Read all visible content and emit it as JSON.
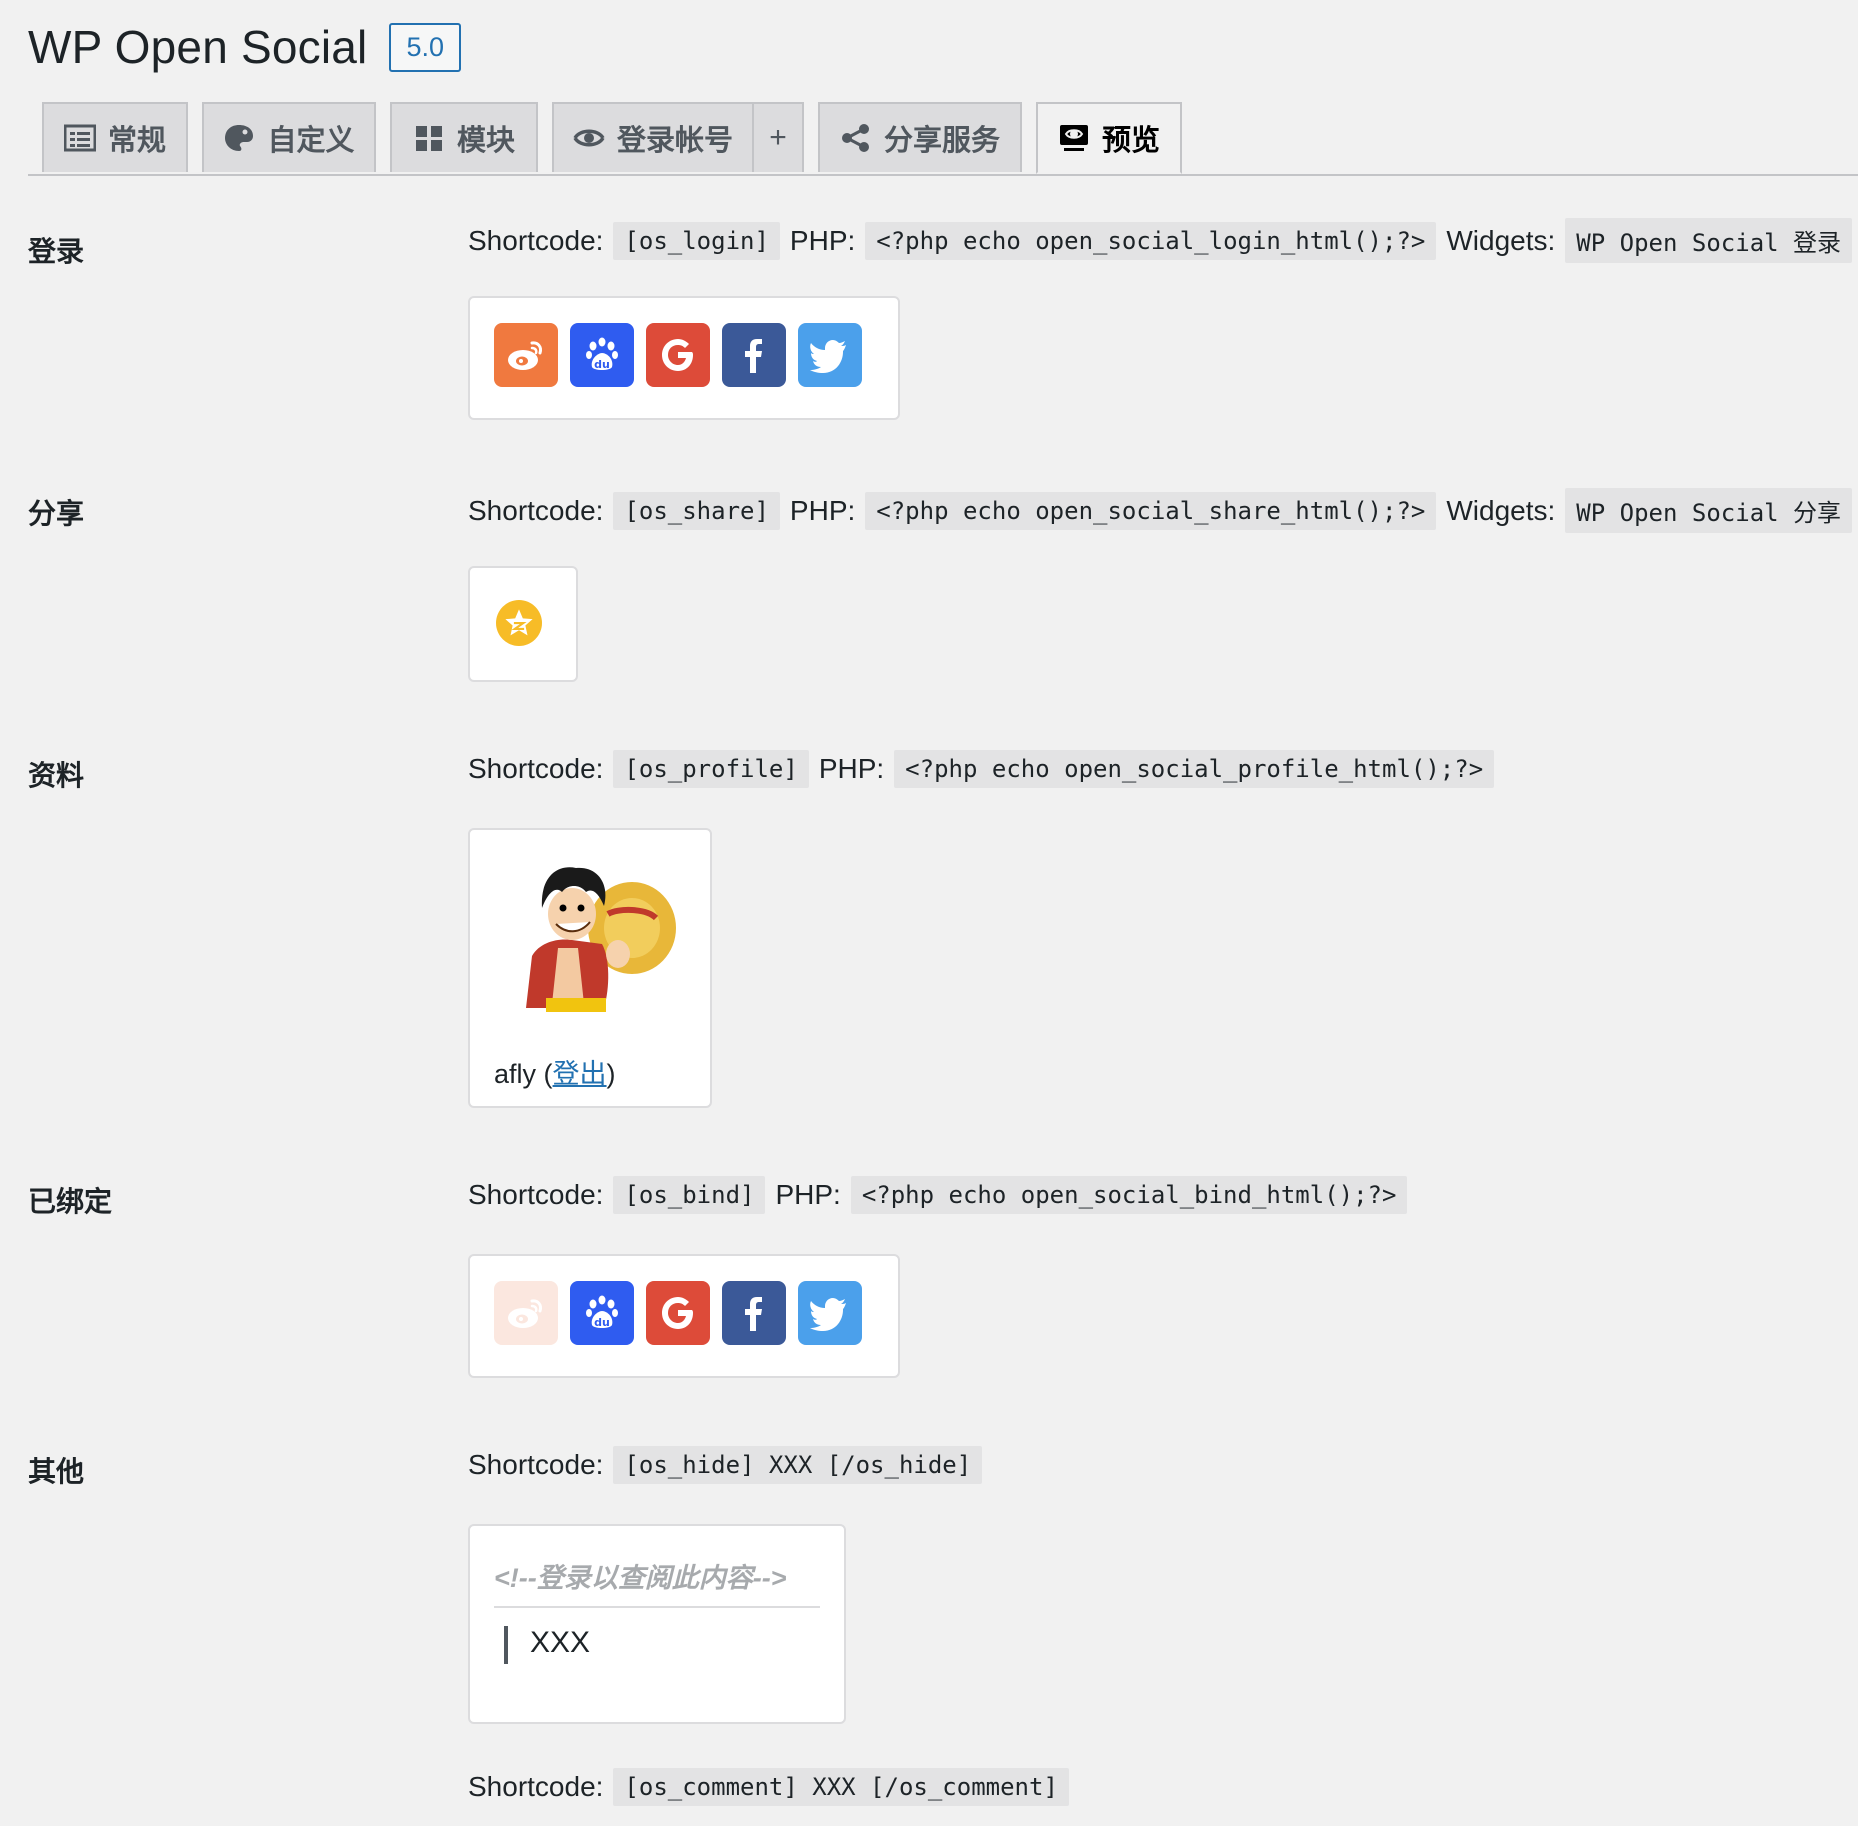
{
  "header": {
    "title": "WP Open Social",
    "version": "5.0"
  },
  "tabs": [
    {
      "label": "常规",
      "icon": "list-icon"
    },
    {
      "label": "自定义",
      "icon": "palette-icon"
    },
    {
      "label": "模块",
      "icon": "grid-icon"
    },
    {
      "label": "登录帐号",
      "icon": "visibility-icon"
    },
    {
      "label": "+",
      "icon": ""
    },
    {
      "label": "分享服务",
      "icon": "share-icon"
    },
    {
      "label": "预览",
      "icon": "screen-icon",
      "active": true
    }
  ],
  "sections": {
    "login": {
      "label": "登录",
      "shortcode_label": "Shortcode:",
      "shortcode": "[os_login]",
      "php_label": "PHP:",
      "php": "<?php echo open_social_login_html();?>",
      "widgets_label": "Widgets:",
      "widgets": "WP Open Social 登录",
      "icons": [
        "weibo-icon",
        "baidu-icon",
        "google-icon",
        "facebook-icon",
        "twitter-icon"
      ]
    },
    "share": {
      "label": "分享",
      "shortcode_label": "Shortcode:",
      "shortcode": "[os_share]",
      "php_label": "PHP:",
      "php": "<?php echo open_social_share_html();?>",
      "widgets_label": "Widgets:",
      "widgets": "WP Open Social 分享",
      "icons": [
        "qzone-icon"
      ]
    },
    "profile": {
      "label": "资料",
      "shortcode_label": "Shortcode:",
      "shortcode": "[os_profile]",
      "php_label": "PHP:",
      "php": "<?php echo open_social_profile_html();?>",
      "username": "afly",
      "open_paren": "(",
      "logout": "登出",
      "close_paren": ")"
    },
    "bind": {
      "label": "已绑定",
      "shortcode_label": "Shortcode:",
      "shortcode": "[os_bind]",
      "php_label": "PHP:",
      "php": "<?php echo open_social_bind_html();?>",
      "icons": [
        "weibo-icon",
        "baidu-icon",
        "google-icon",
        "facebook-icon",
        "twitter-icon"
      ]
    },
    "other": {
      "label": "其他",
      "shortcode_label": "Shortcode:",
      "shortcode": "[os_hide] XXX [/os_hide]",
      "hide_comment": "<!--登录以查阅此内容-->",
      "hide_content": "XXX",
      "comment_shortcode_label": "Shortcode:",
      "comment_shortcode": "[os_comment] XXX [/os_comment]"
    }
  },
  "colors": {
    "accent": "#2271b1",
    "weibo": "#f0793f",
    "baidu": "#2f5cf0",
    "google": "#dd4b39",
    "facebook": "#3b5998",
    "twitter": "#4ba0eb",
    "qzone": "#f7bc27"
  }
}
